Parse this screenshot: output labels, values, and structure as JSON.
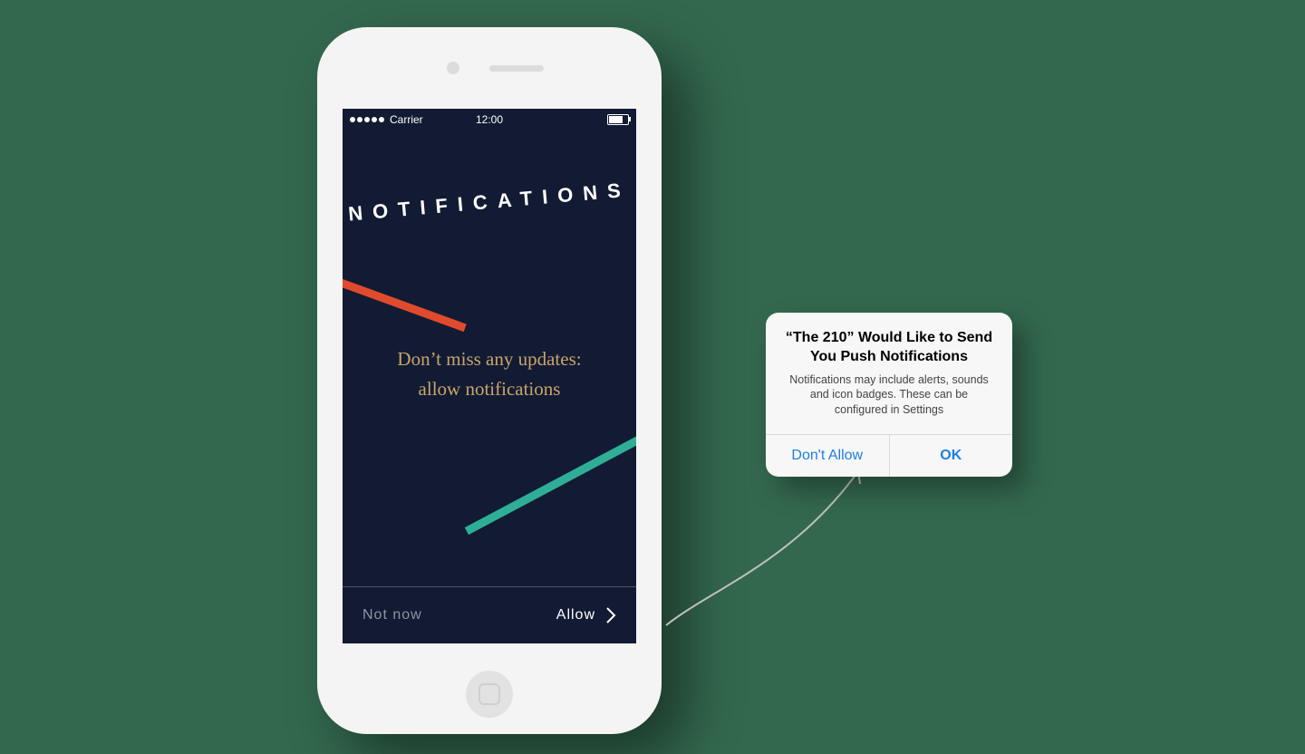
{
  "statusbar": {
    "carrier": "Carrier",
    "time": "12:00"
  },
  "screen": {
    "heading": "NOTIFICATIONS",
    "line1": "Don’t miss any updates:",
    "line2": "allow notifications"
  },
  "footer": {
    "left": "Not now",
    "right": "Allow"
  },
  "alert": {
    "title": "“The 210” Would Like to Send You Push Notifications",
    "message": "Notifications may include alerts, sounds and icon badges. These can be configured in Settings",
    "deny": "Don't Allow",
    "ok": "OK"
  },
  "colors": {
    "bg": "#33684e",
    "screen": "#121b33",
    "gold": "#c9a46b",
    "red": "#e14b2d",
    "teal": "#2fae97",
    "ios_blue": "#1e7fe0"
  }
}
